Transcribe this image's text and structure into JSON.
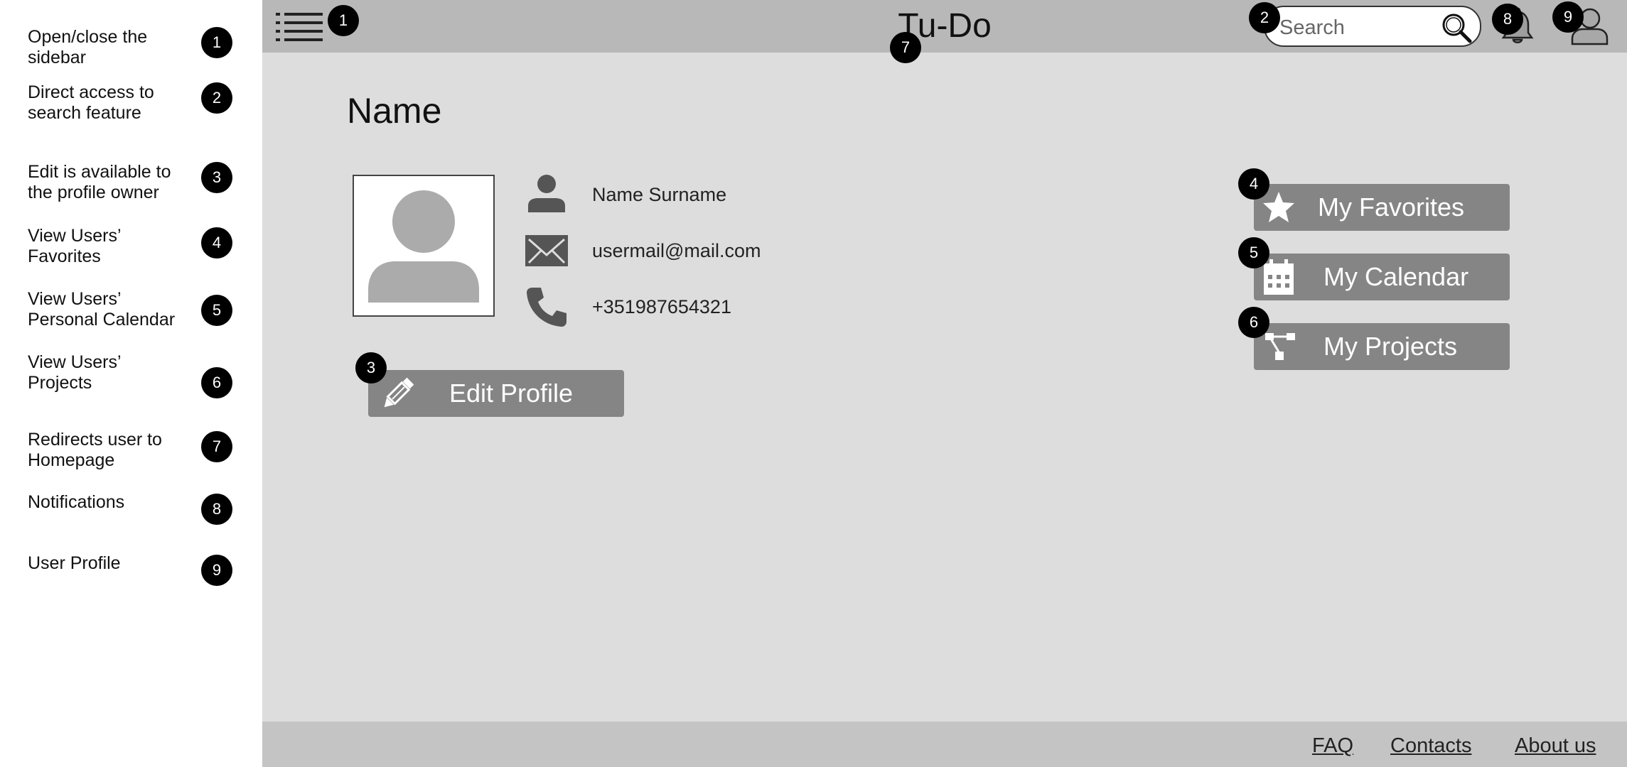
{
  "legend": [
    {
      "text": "Open/close the sidebar",
      "badge": "1"
    },
    {
      "text": "Direct access to search feature",
      "badge": "2"
    },
    {
      "text": "Edit is available to the profile owner",
      "badge": "3"
    },
    {
      "text": "View Users’ Favorites",
      "badge": "4"
    },
    {
      "text": "View Users’ Personal Calendar",
      "badge": "5"
    },
    {
      "text": "View Users’ Projects",
      "badge": "6"
    },
    {
      "text": "Redirects user to Homepage",
      "badge": "7"
    },
    {
      "text": "Notifications",
      "badge": "8"
    },
    {
      "text": "User Profile",
      "badge": "9"
    }
  ],
  "header": {
    "title": "Tu-Do",
    "search_placeholder": "Search",
    "icons": {
      "menu": "hamburger-menu-icon",
      "search": "magnifier-icon",
      "notifications": "bell-icon",
      "user": "user-profile-icon"
    }
  },
  "profile": {
    "page_title": "Name",
    "full_name": "Name Surname",
    "email": "usermail@mail.com",
    "phone": "+351987654321",
    "edit_button": "Edit Profile"
  },
  "actions": {
    "favorites": "My Favorites",
    "calendar": "My Calendar",
    "projects": "My Projects"
  },
  "footer": {
    "faq": "FAQ",
    "contacts": "Contacts",
    "about": "About us"
  },
  "colors": {
    "header_bg": "#b8b8b8",
    "page_bg": "#dddddd",
    "footer_bg": "#c4c4c4",
    "button_bg": "#858585",
    "icon_gray": "#555555",
    "badge_bg": "#000000"
  }
}
